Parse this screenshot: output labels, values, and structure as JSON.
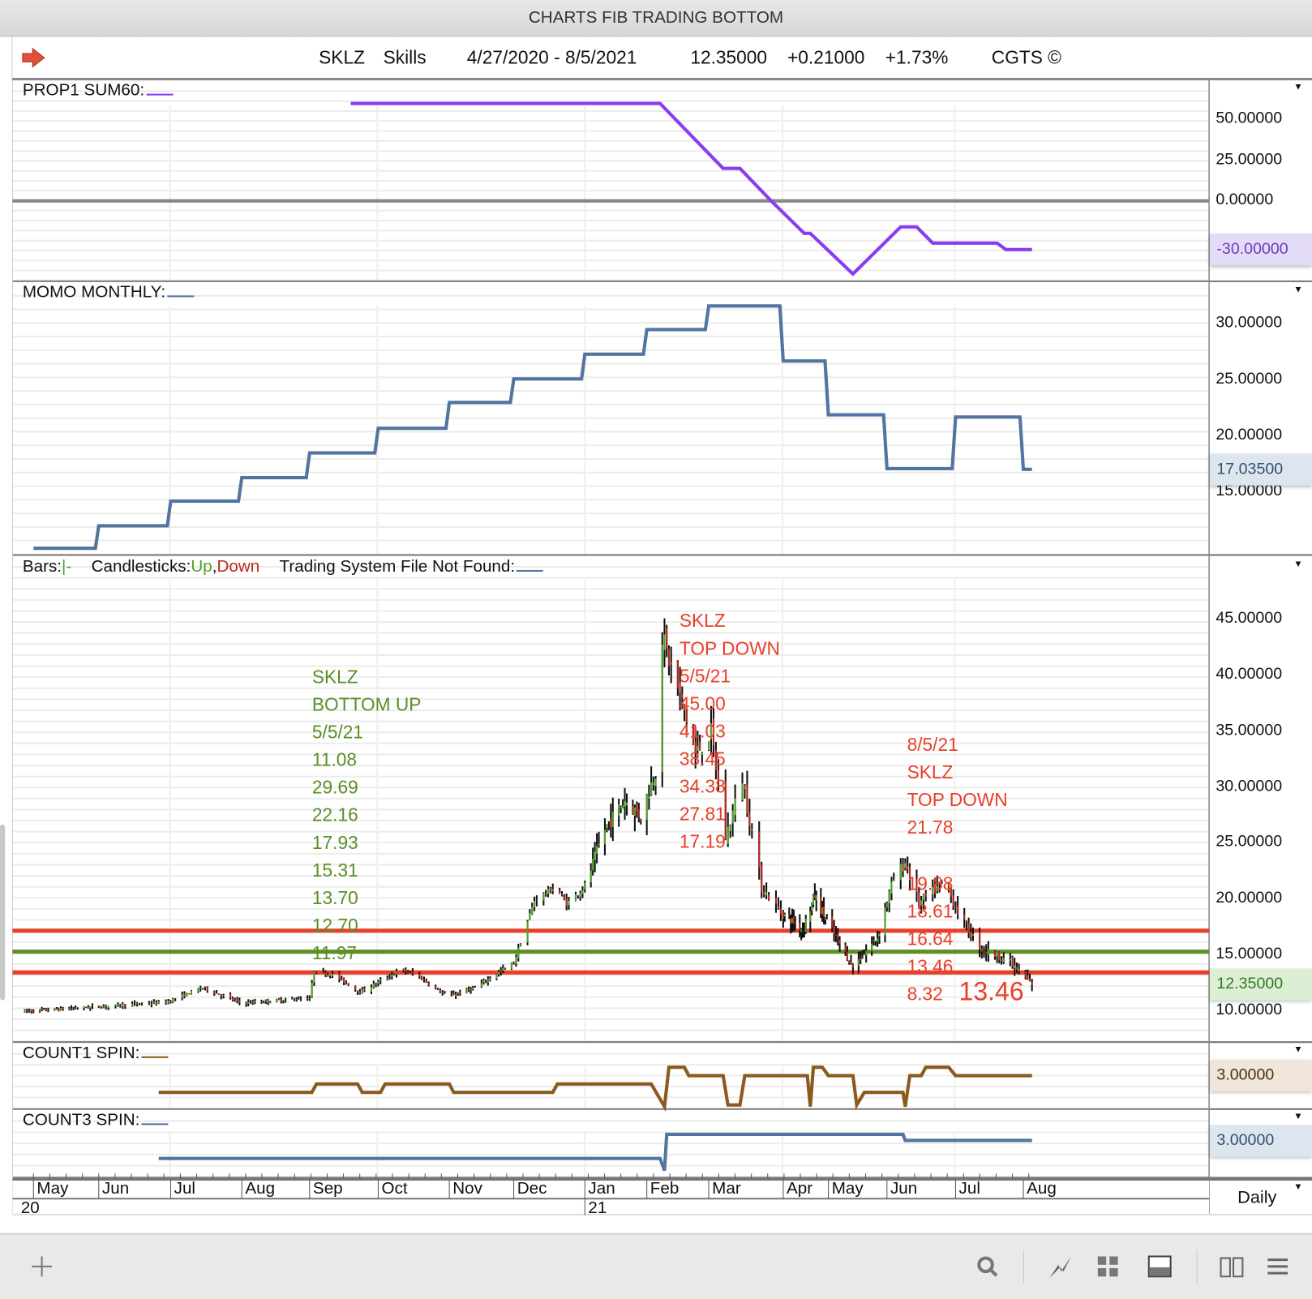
{
  "window_title": "CHARTS FIB TRADING BOTTOM",
  "header": {
    "ticker": "SKLZ",
    "name": "Skills",
    "date_range": "4/27/2020 - 8/5/2021",
    "last": "12.35000",
    "change": "+0.21000",
    "change_pct": "+1.73%",
    "copyright": "CGTS ©"
  },
  "panels": {
    "prop1": {
      "title": "PROP1 SUM60:",
      "badge": "-30.00000",
      "yticks": [
        "50.00000",
        "25.00000",
        "0.00000"
      ]
    },
    "momo": {
      "title": "MOMO MONTHLY:",
      "badge": "17.03500",
      "yticks": [
        "30.00000",
        "25.00000",
        "20.00000",
        "15.00000"
      ]
    },
    "price": {
      "badge": "12.35000",
      "yticks": [
        "45.00000",
        "40.00000",
        "35.00000",
        "30.00000",
        "25.00000",
        "20.00000",
        "15.00000",
        "10.00000"
      ]
    },
    "count1": {
      "title": "COUNT1 SPIN:",
      "badge": "3.00000"
    },
    "count3": {
      "title": "COUNT3 SPIN:",
      "badge": "3.00000"
    }
  },
  "price_legend": {
    "bars_label": "Bars:",
    "bars_symbol": "|-",
    "candles_label": "Candlesticks:",
    "up": "Up",
    "sep": ",",
    "down": "Down",
    "system_label": "Trading System File Not Found:"
  },
  "annotations": {
    "bottom_up": [
      "SKLZ",
      "BOTTOM UP",
      "5/5/21",
      "11.08",
      "29.69",
      "22.16",
      "17.93",
      "15.31",
      "13.70",
      "12.70",
      "11.97"
    ],
    "top_down": [
      "SKLZ",
      "TOP DOWN",
      "5/5/21",
      "45.00",
      "41.03",
      "38.45",
      "34.38",
      "27.81",
      "17.19"
    ],
    "top_down_aug_head": [
      "8/5/21",
      "SKLZ",
      "TOP DOWN",
      "21.78"
    ],
    "top_down_aug_levels": [
      "19.88",
      "18.61",
      "16.64",
      "13.46",
      "8.32"
    ],
    "highlight": "13.46"
  },
  "date_axis": {
    "months": [
      "May",
      "Jun",
      "Jul",
      "Aug",
      "Sep",
      "Oct",
      "Nov",
      "Dec",
      "Jan",
      "Feb",
      "Mar",
      "Apr",
      "May",
      "Jun",
      "Jul",
      "Aug"
    ],
    "years": [
      "20",
      "21"
    ],
    "interval": "Daily"
  },
  "colors": {
    "prop1": "#8a3cf0",
    "momo": "#52759f",
    "count1": "#8a5a1e",
    "count3": "#52759f",
    "up": "#4fa228",
    "down": "#b8281e",
    "fib_red": "#e8402a",
    "fib_green": "#5e8f26",
    "annot_green": "#5a8f24",
    "annot_red": "#e8402a"
  },
  "chart_data": [
    {
      "type": "line",
      "name": "PROP1 SUM60",
      "ylim": [
        -50,
        62
      ],
      "points": [
        [
          "2020-09-19",
          60
        ],
        [
          "2021-02-07",
          60
        ],
        [
          "2021-03-07",
          20
        ],
        [
          "2021-03-14",
          20
        ],
        [
          "2021-03-27",
          0
        ],
        [
          "2021-04-15",
          -20
        ],
        [
          "2021-04-19",
          -20
        ],
        [
          "2021-05-14",
          -45
        ],
        [
          "2021-06-07",
          -16
        ],
        [
          "2021-06-14",
          -16
        ],
        [
          "2021-06-21",
          -26
        ],
        [
          "2021-07-20",
          -26
        ],
        [
          "2021-07-24",
          -30
        ],
        [
          "2021-08-05",
          -30
        ]
      ],
      "reference_line": 0,
      "last": -30
    },
    {
      "type": "line",
      "name": "MOMO MONTHLY",
      "step": true,
      "ylim": [
        8,
        33
      ],
      "steps": [
        [
          "2020-05-01",
          10
        ],
        [
          "2020-06-01",
          12
        ],
        [
          "2020-07-01",
          14.2
        ],
        [
          "2020-08-01",
          16.3
        ],
        [
          "2020-09-01",
          18.5
        ],
        [
          "2020-10-01",
          20.7
        ],
        [
          "2020-11-01",
          23
        ],
        [
          "2020-12-01",
          25.1
        ],
        [
          "2021-01-01",
          27.3
        ],
        [
          "2021-02-01",
          29.5
        ],
        [
          "2021-03-01",
          31.6
        ],
        [
          "2021-04-01",
          26.7
        ],
        [
          "2021-05-01",
          21.9
        ],
        [
          "2021-06-01",
          17.1
        ],
        [
          "2021-07-01",
          21.7
        ],
        [
          "2021-08-01",
          17.035
        ]
      ],
      "end": "2021-08-05",
      "last": 17.035
    },
    {
      "type": "ohlc",
      "name": "SKLZ",
      "ylim": [
        9,
        47
      ],
      "start": "2020-04-27",
      "end": "2021-08-05",
      "last": 12.35,
      "path": [
        [
          "2020-04-27",
          10.0
        ],
        [
          "2020-05-24",
          10.3
        ],
        [
          "2020-06-29",
          10.8
        ],
        [
          "2020-07-15",
          12.1
        ],
        [
          "2020-08-01",
          10.7
        ],
        [
          "2020-08-20",
          11.0
        ],
        [
          "2020-09-01",
          11.2
        ],
        [
          "2020-09-03",
          13.6
        ],
        [
          "2020-09-12",
          13.2
        ],
        [
          "2020-09-23",
          11.7
        ],
        [
          "2020-10-11",
          13.7
        ],
        [
          "2020-10-18",
          13.2
        ],
        [
          "2020-10-31",
          11.3
        ],
        [
          "2020-11-13",
          12.1
        ],
        [
          "2020-11-25",
          13.6
        ],
        [
          "2020-12-01",
          14.3
        ],
        [
          "2020-12-10",
          19.9
        ],
        [
          "2020-12-19",
          21.1
        ],
        [
          "2020-12-24",
          19.6
        ],
        [
          "2021-01-01",
          21.1
        ],
        [
          "2021-01-11",
          26.3
        ],
        [
          "2021-01-21",
          28.9
        ],
        [
          "2021-01-29",
          27.4
        ],
        [
          "2021-02-05",
          31.5
        ],
        [
          "2021-02-08",
          43.5
        ],
        [
          "2021-02-11",
          41.3
        ],
        [
          "2021-02-17",
          37.5
        ],
        [
          "2021-02-23",
          33.0
        ],
        [
          "2021-03-02",
          34.9
        ],
        [
          "2021-03-08",
          25.5
        ],
        [
          "2021-03-15",
          30.8
        ],
        [
          "2021-03-23",
          21.1
        ],
        [
          "2021-03-31",
          18.8
        ],
        [
          "2021-04-14",
          17.3
        ],
        [
          "2021-04-22",
          20.3
        ],
        [
          "2021-05-05",
          16.6
        ],
        [
          "2021-05-14",
          14.0
        ],
        [
          "2021-05-27",
          16.6
        ],
        [
          "2021-06-04",
          21.8
        ],
        [
          "2021-06-09",
          23.3
        ],
        [
          "2021-06-15",
          19.6
        ],
        [
          "2021-06-26",
          21.5
        ],
        [
          "2021-07-04",
          18.1
        ],
        [
          "2021-07-13",
          15.5
        ],
        [
          "2021-07-24",
          14.7
        ],
        [
          "2021-08-05",
          12.35
        ]
      ],
      "fib_lines": [
        {
          "value": 17.19,
          "color": "red"
        },
        {
          "value": 15.31,
          "color": "green"
        },
        {
          "value": 13.46,
          "color": "red"
        }
      ]
    },
    {
      "type": "line",
      "name": "COUNT1 SPIN",
      "ylim": [
        -1,
        5
      ],
      "points": [
        [
          "2020-06-26",
          1
        ],
        [
          "2020-09-02",
          1
        ],
        [
          "2020-09-04",
          2
        ],
        [
          "2020-09-22",
          2
        ],
        [
          "2020-09-24",
          1
        ],
        [
          "2020-10-02",
          1
        ],
        [
          "2020-10-04",
          2
        ],
        [
          "2020-11-01",
          2
        ],
        [
          "2020-11-03",
          1
        ],
        [
          "2020-12-18",
          1
        ],
        [
          "2020-12-20",
          2
        ],
        [
          "2021-02-03",
          2
        ],
        [
          "2021-02-09",
          -0.7
        ],
        [
          "2021-02-11",
          4
        ],
        [
          "2021-02-18",
          4
        ],
        [
          "2021-02-20",
          3
        ],
        [
          "2021-03-07",
          3
        ],
        [
          "2021-03-09",
          -0.5
        ],
        [
          "2021-03-14",
          -0.5
        ],
        [
          "2021-03-16",
          3
        ],
        [
          "2021-04-17",
          3
        ],
        [
          "2021-04-19",
          -0.7
        ],
        [
          "2021-04-21",
          4
        ],
        [
          "2021-04-27",
          4
        ],
        [
          "2021-05-01",
          3
        ],
        [
          "2021-05-14",
          3
        ],
        [
          "2021-05-16",
          -0.5
        ],
        [
          "2021-05-20",
          1
        ],
        [
          "2021-06-08",
          1
        ],
        [
          "2021-06-09",
          -0.7
        ],
        [
          "2021-06-11",
          3
        ],
        [
          "2021-06-16",
          3
        ],
        [
          "2021-06-18",
          4
        ],
        [
          "2021-06-28",
          4
        ],
        [
          "2021-07-01",
          3
        ],
        [
          "2021-08-05",
          3
        ]
      ],
      "last": 3
    },
    {
      "type": "line",
      "name": "COUNT3 SPIN",
      "ylim": [
        -2,
        5
      ],
      "points": [
        [
          "2020-06-26",
          0
        ],
        [
          "2021-02-07",
          0
        ],
        [
          "2021-02-09",
          -2
        ],
        [
          "2021-02-10",
          4
        ],
        [
          "2021-06-08",
          4
        ],
        [
          "2021-06-09",
          3
        ],
        [
          "2021-08-05",
          3
        ]
      ],
      "last": 3
    }
  ]
}
